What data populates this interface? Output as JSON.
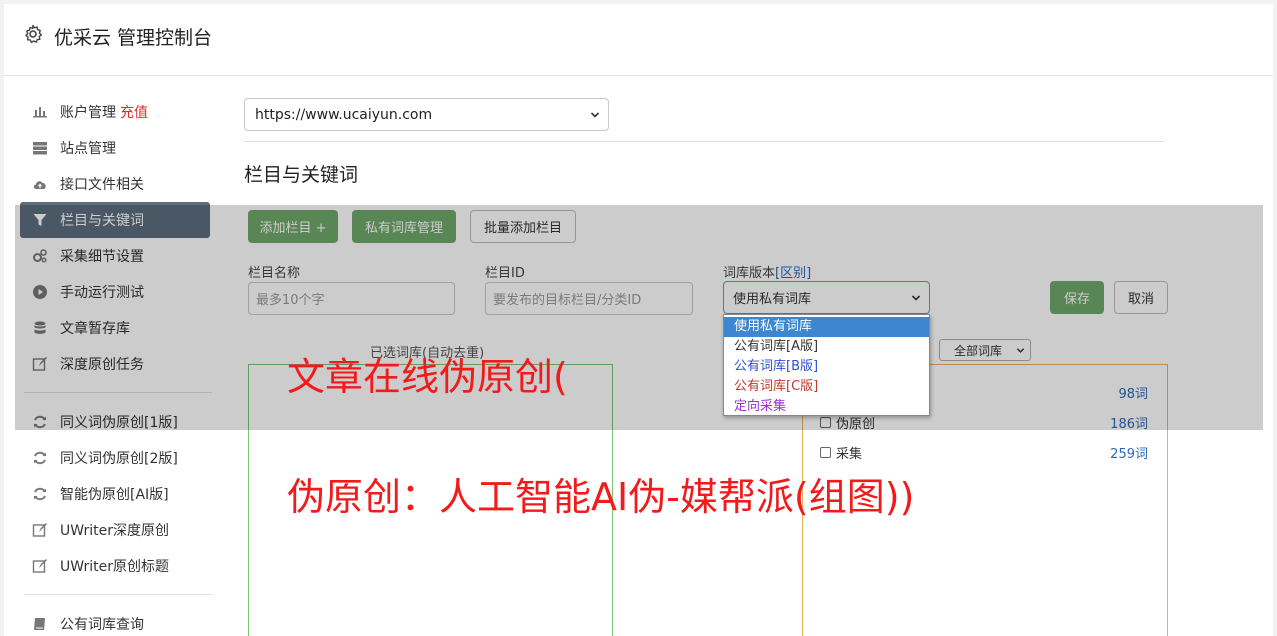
{
  "header": {
    "title": "优采云 管理控制台"
  },
  "sidebar": {
    "items": [
      {
        "label": "账户管理",
        "badge": "充值",
        "icon": "bar-chart-icon"
      },
      {
        "label": "站点管理",
        "icon": "server-icon"
      },
      {
        "label": "接口文件相关",
        "icon": "cloud-upload-icon"
      },
      {
        "label": "栏目与关键词",
        "icon": "filter-icon"
      },
      {
        "label": "采集细节设置",
        "icon": "gears-icon"
      },
      {
        "label": "手动运行测试",
        "icon": "play-icon"
      },
      {
        "label": "文章暂存库",
        "icon": "database-icon"
      },
      {
        "label": "深度原创任务",
        "icon": "edit-icon"
      },
      {
        "label": "同义词伪原创[1版]",
        "icon": "refresh-icon"
      },
      {
        "label": "同义词伪原创[2版]",
        "icon": "refresh-icon"
      },
      {
        "label": "智能伪原创[AI版]",
        "icon": "refresh-icon"
      },
      {
        "label": "UWriter深度原创",
        "icon": "edit-icon"
      },
      {
        "label": "UWriter原创标题",
        "icon": "edit-icon"
      },
      {
        "label": "公有词库查询",
        "icon": "book-icon"
      }
    ]
  },
  "main": {
    "site_url": "https://www.ucaiyun.com",
    "section_title": "栏目与关键词",
    "buttons": {
      "add_column": "添加栏目 +",
      "private_dict": "私有词库管理",
      "batch_add": "批量添加栏目",
      "save": "保存",
      "cancel": "取消"
    },
    "form": {
      "column_name_label": "栏目名称",
      "column_name_placeholder": "最多10个字",
      "column_id_label": "栏目ID",
      "column_id_placeholder": "要发布的目标栏目/分类ID",
      "dict_version_label": "词库版本",
      "dict_version_link": "[区别]",
      "dict_version_value": "使用私有词库"
    },
    "selected_dict_title": "已选词库(自动去重)",
    "dict_filter_value": "全部词库",
    "dropdown_options": [
      "使用私有词库",
      "公有词库[A版]",
      "公有词库[B版]",
      "公有词库[C版]",
      "定向采集"
    ],
    "dicts": [
      {
        "name": "",
        "count": "98词"
      },
      {
        "name": "伪原创",
        "count": "186词"
      },
      {
        "name": "采集",
        "count": "259词"
      }
    ]
  },
  "watermark": {
    "line1": "文章在线伪原创(",
    "line2": "伪原创：人工智能AI伪-媒帮派(组图))"
  }
}
